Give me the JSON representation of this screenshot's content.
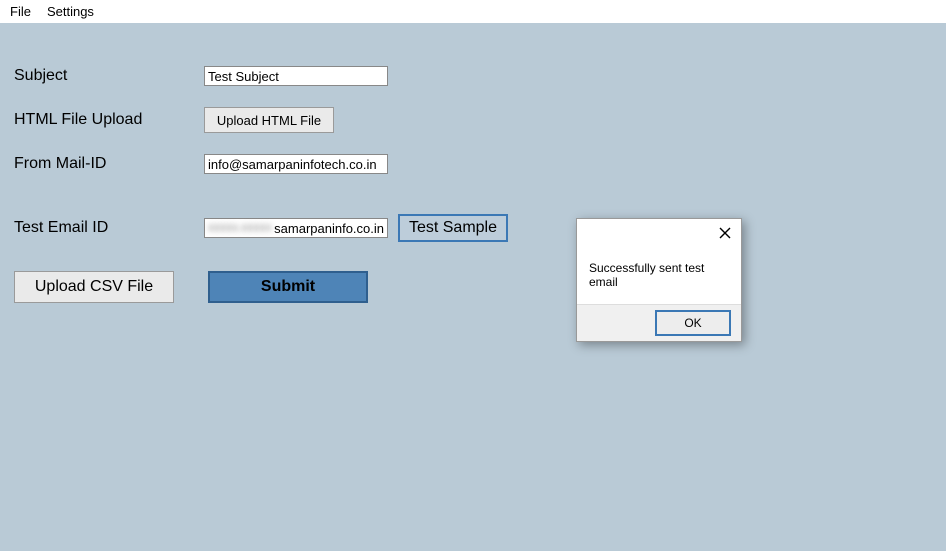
{
  "menu": {
    "file": "File",
    "settings": "Settings"
  },
  "labels": {
    "subject": "Subject",
    "html_upload": "HTML File Upload",
    "from_mail": "From Mail-ID",
    "test_email": "Test Email ID"
  },
  "fields": {
    "subject_value": "Test Subject",
    "from_mail_value": "info@samarpaninfotech.co.in",
    "test_email_value": "samarpaninfo.co.in",
    "test_email_obscured_prefix": "xxxxx.xxxxx"
  },
  "buttons": {
    "upload_html": "Upload HTML File",
    "test_sample": "Test Sample",
    "upload_csv": "Upload CSV File",
    "submit": "Submit"
  },
  "dialog": {
    "message": "Successfully sent test email",
    "ok": "OK"
  }
}
